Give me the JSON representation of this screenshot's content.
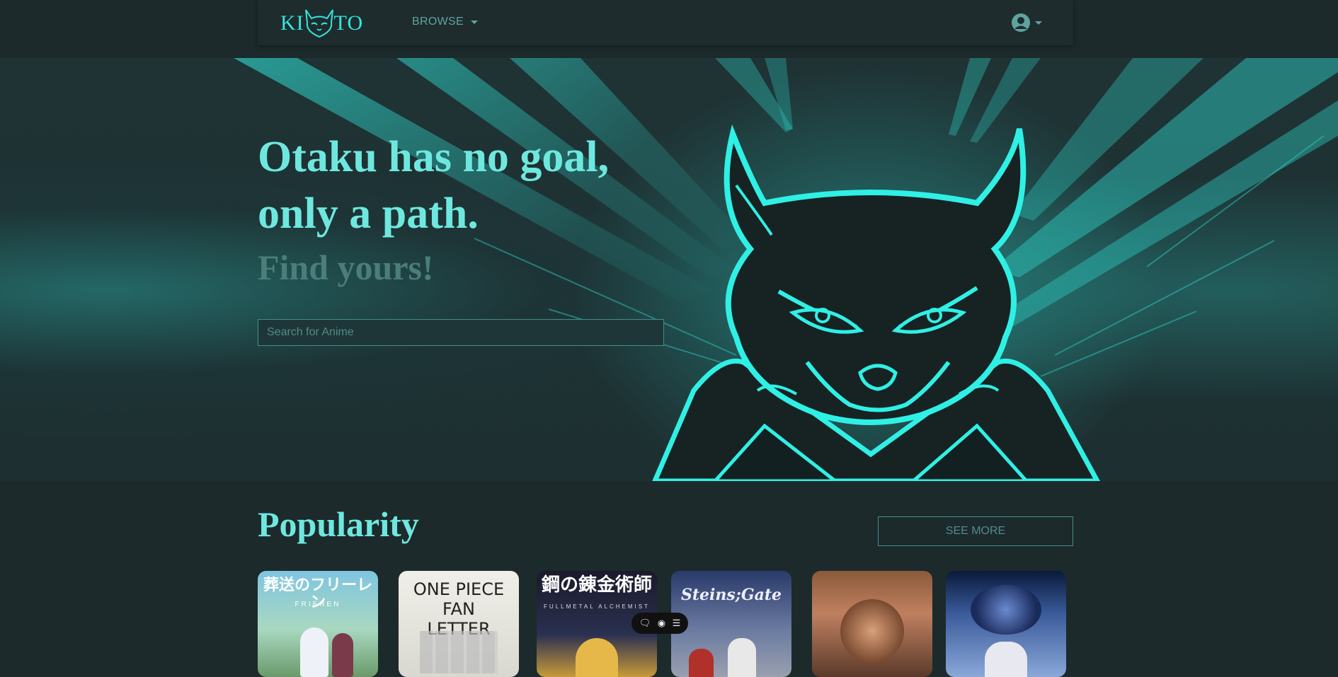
{
  "nav": {
    "logo_left": "KI",
    "logo_right": "TO",
    "browse_label": "BROWSE"
  },
  "hero": {
    "headline_line1": "Otaku has no goal,",
    "headline_line2": "only a path.",
    "subline": "Find yours!",
    "search_placeholder": "Search for Anime"
  },
  "popularity": {
    "title": "Popularity",
    "see_more_label": "SEE MORE",
    "cards": [
      {
        "title": "葬送のフリーレン",
        "subtitle": "FRIEREN"
      },
      {
        "title": "ONE PIECE FAN LETTER",
        "subtitle": ""
      },
      {
        "title": "鋼の錬金術師",
        "subtitle": "FULLMETAL ALCHEMIST"
      },
      {
        "title": "Steins;Gate",
        "subtitle": ""
      },
      {
        "title": "",
        "subtitle": ""
      },
      {
        "title": "",
        "subtitle": ""
      }
    ]
  },
  "colors": {
    "accent": "#33e6dc",
    "headline": "#6ee8df",
    "background": "#1c2a2c"
  },
  "icons": [
    "account-icon",
    "caret-down-icon",
    "comment-icon",
    "eye-icon",
    "menu-icon"
  ]
}
